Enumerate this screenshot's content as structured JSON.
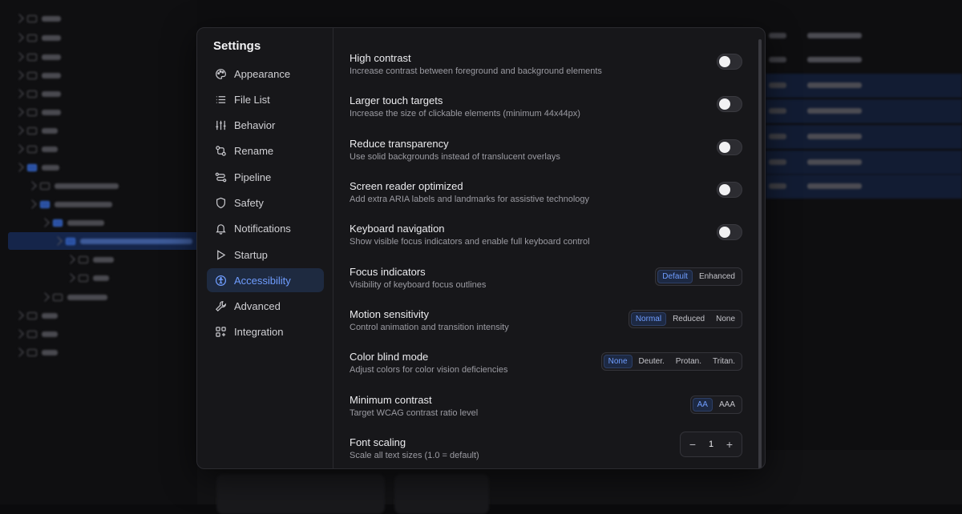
{
  "settings": {
    "title": "Settings",
    "nav": [
      {
        "label": "Appearance",
        "icon": "palette-icon",
        "active": false
      },
      {
        "label": "File List",
        "icon": "list-icon",
        "active": false
      },
      {
        "label": "Behavior",
        "icon": "sliders-icon",
        "active": false
      },
      {
        "label": "Rename",
        "icon": "rename-icon",
        "active": false
      },
      {
        "label": "Pipeline",
        "icon": "pipeline-icon",
        "active": false
      },
      {
        "label": "Safety",
        "icon": "shield-icon",
        "active": false
      },
      {
        "label": "Notifications",
        "icon": "bell-icon",
        "active": false
      },
      {
        "label": "Startup",
        "icon": "play-icon",
        "active": false
      },
      {
        "label": "Accessibility",
        "icon": "accessibility-icon",
        "active": true
      },
      {
        "label": "Advanced",
        "icon": "wrench-icon",
        "active": false
      },
      {
        "label": "Integration",
        "icon": "grid-plus-icon",
        "active": false
      }
    ],
    "rows": {
      "high_contrast": {
        "label": "High contrast",
        "desc": "Increase contrast between foreground and background elements",
        "value": false
      },
      "larger_targets": {
        "label": "Larger touch targets",
        "desc": "Increase the size of clickable elements (minimum 44x44px)",
        "value": false
      },
      "reduce_transparency": {
        "label": "Reduce transparency",
        "desc": "Use solid backgrounds instead of translucent overlays",
        "value": false
      },
      "screen_reader": {
        "label": "Screen reader optimized",
        "desc": "Add extra ARIA labels and landmarks for assistive technology",
        "value": false
      },
      "keyboard_nav": {
        "label": "Keyboard navigation",
        "desc": "Show visible focus indicators and enable full keyboard control",
        "value": false
      },
      "focus_indicators": {
        "label": "Focus indicators",
        "desc": "Visibility of keyboard focus outlines",
        "options": [
          "Default",
          "Enhanced"
        ],
        "selected": "Default"
      },
      "motion": {
        "label": "Motion sensitivity",
        "desc": "Control animation and transition intensity",
        "options": [
          "Normal",
          "Reduced",
          "None"
        ],
        "selected": "Normal"
      },
      "color_blind": {
        "label": "Color blind mode",
        "desc": "Adjust colors for color vision deficiencies",
        "options": [
          "None",
          "Deuter.",
          "Protan.",
          "Tritan."
        ],
        "selected": "None"
      },
      "min_contrast": {
        "label": "Minimum contrast",
        "desc": "Target WCAG contrast ratio level",
        "options": [
          "AA",
          "AAA"
        ],
        "selected": "AA"
      },
      "font_scaling": {
        "label": "Font scaling",
        "desc": "Scale all text sizes (1.0 = default)",
        "value": "1",
        "decrement": "−",
        "increment": "+"
      }
    }
  },
  "colors": {
    "accent": "#6f9dff",
    "active_bg": "#1e2a40",
    "modal_bg": "#17171a"
  }
}
